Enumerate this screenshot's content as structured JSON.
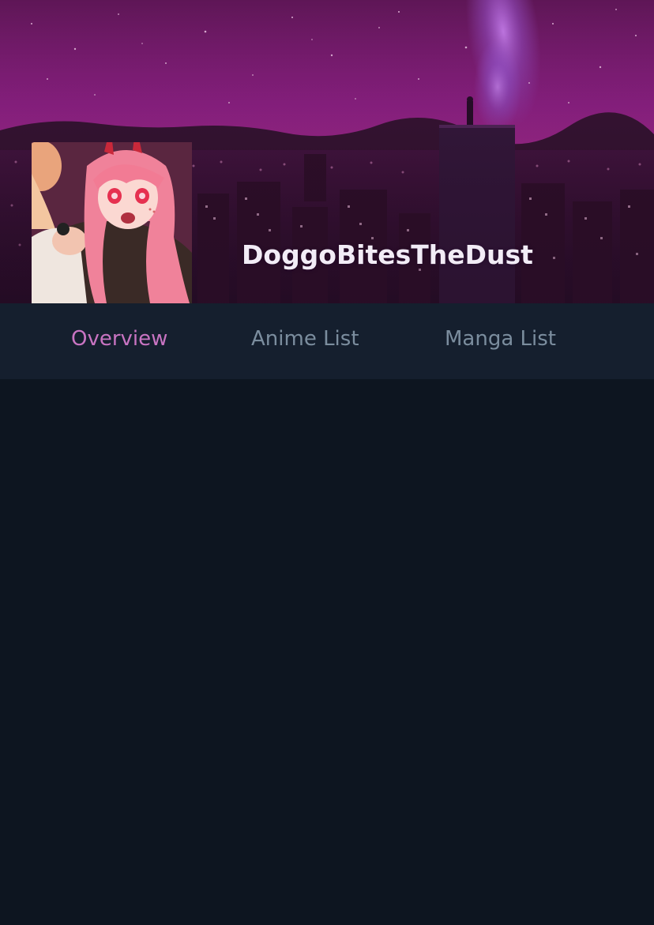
{
  "profile": {
    "username": "DoggoBitesTheDust"
  },
  "nav": {
    "tabs": [
      {
        "label": "Overview",
        "active": true
      },
      {
        "label": "Anime List",
        "active": false
      },
      {
        "label": "Manga List",
        "active": false
      }
    ]
  },
  "colors": {
    "page_background": "#0d1520",
    "nav_background": "#151f2e",
    "active_tab": "#c874c2",
    "inactive_tab": "#7b8d9e",
    "username_text": "#f2ecf6"
  }
}
